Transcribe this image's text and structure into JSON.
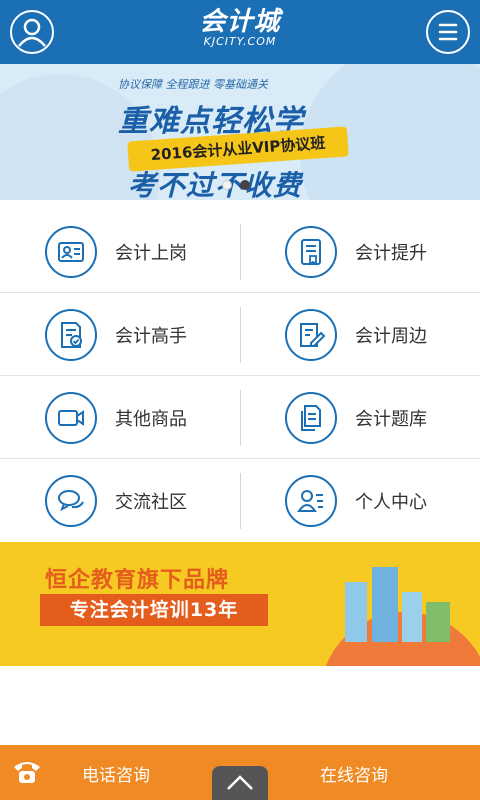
{
  "header": {
    "logo_main": "会计城",
    "logo_sub": "KJCITY.COM",
    "user_icon": "user-icon",
    "menu_icon": "menu-icon",
    "color": "#1a6fb5"
  },
  "banner": {
    "tagline": "协议保障 全程跟进 零基础通关",
    "title": "重难点轻松学",
    "ribbon": "2016会计从业VIP协议班",
    "subtitle": "考不过不收费",
    "active_slide": 2,
    "slide_count": 2
  },
  "grid": {
    "items": [
      {
        "label": "会计上岗",
        "icon": "id-card-icon"
      },
      {
        "label": "会计提升",
        "icon": "book-bookmark-icon"
      },
      {
        "label": "会计高手",
        "icon": "certificate-icon"
      },
      {
        "label": "会计周边",
        "icon": "edit-document-icon"
      },
      {
        "label": "其他商品",
        "icon": "video-camera-icon"
      },
      {
        "label": "会计题库",
        "icon": "documents-icon"
      },
      {
        "label": "交流社区",
        "icon": "chat-bubbles-icon"
      },
      {
        "label": "个人中心",
        "icon": "profile-icon"
      }
    ]
  },
  "promo": {
    "title": "恒企教育旗下品牌",
    "subtitle": "专注会计培训13年"
  },
  "footer": {
    "phone_label": "电话咨询",
    "online_label": "在线咨询",
    "phone_icon": "phone-icon",
    "up_icon": "chevron-up-icon",
    "color": "#f08a24"
  }
}
